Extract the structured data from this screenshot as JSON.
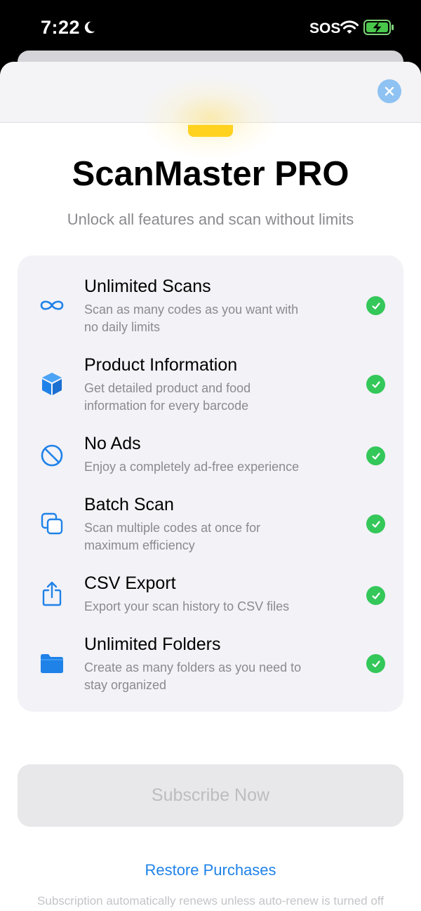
{
  "status_bar": {
    "time": "7:22",
    "carrier": "SOS",
    "icons": [
      "moon-icon",
      "wifi-icon",
      "battery-charging-icon"
    ]
  },
  "header": {
    "close_icon": "close-icon",
    "accent_color": "#ffd21f"
  },
  "hero": {
    "title": "ScanMaster PRO",
    "subtitle": "Unlock all features and scan without limits"
  },
  "features": [
    {
      "icon": "infinity-icon",
      "title": "Unlimited Scans",
      "desc_line1": "Scan as many codes as you want with",
      "desc_line2": "no daily limits"
    },
    {
      "icon": "cube-icon",
      "title": "Product Information",
      "desc_line1": "Get detailed product and food",
      "desc_line2": "information for every barcode"
    },
    {
      "icon": "no-symbol-icon",
      "title": "No Ads",
      "desc_line1": "Enjoy a completely ad-free experience",
      "desc_line2": ""
    },
    {
      "icon": "copy-icon",
      "title": "Batch Scan",
      "desc_line1": "Scan multiple codes at once for",
      "desc_line2": "maximum efficiency"
    },
    {
      "icon": "share-icon",
      "title": "CSV Export",
      "desc_line1": "Export your scan history to CSV files",
      "desc_line2": ""
    },
    {
      "icon": "folder-icon",
      "title": "Unlimited Folders",
      "desc_line1": "Create as many folders as you need to",
      "desc_line2": "stay organized"
    }
  ],
  "actions": {
    "subscribe_label": "Subscribe Now",
    "restore_label": "Restore Purchases"
  },
  "footer": {
    "note": "Subscription automatically renews unless auto-renew is turned off"
  },
  "colors": {
    "accent_blue": "#1f82e8",
    "check_green": "#34c759",
    "card_bg": "#f2f2f7"
  }
}
